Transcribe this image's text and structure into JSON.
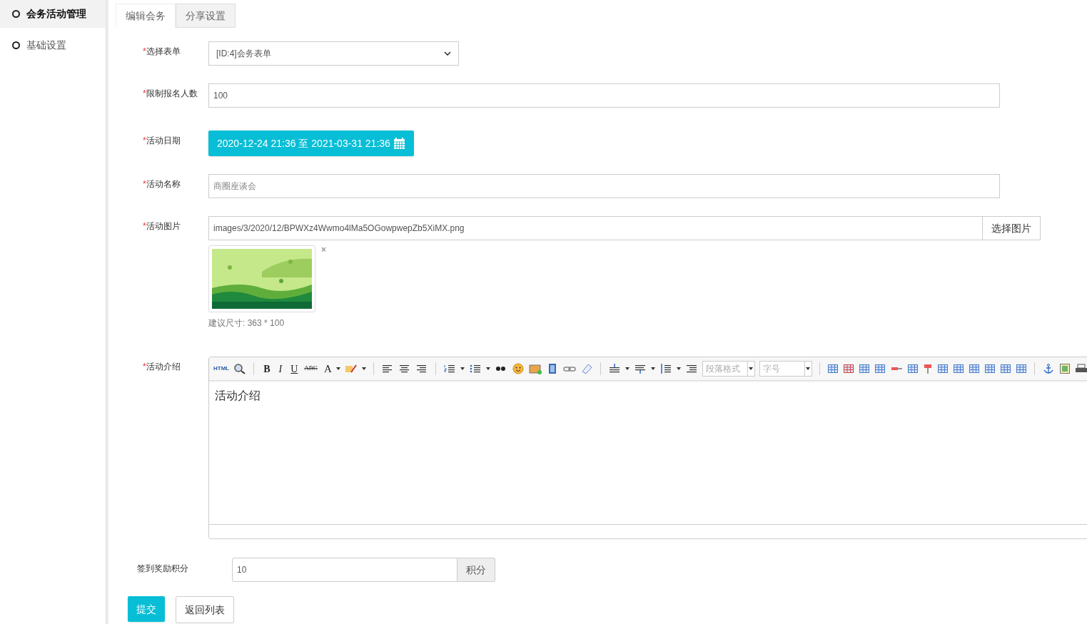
{
  "sidebar": {
    "items": [
      {
        "label": "会务活动管理",
        "selected": true
      },
      {
        "label": "基础设置",
        "selected": false
      }
    ]
  },
  "tabs": [
    {
      "label": "编辑会务",
      "selected": true
    },
    {
      "label": "分享设置",
      "selected": false
    }
  ],
  "form": {
    "required_mark": "*",
    "form_select": {
      "label": "选择表单",
      "value": "[ID:4]会务表单"
    },
    "limit": {
      "label": "限制报名人数",
      "value": "100"
    },
    "date": {
      "label": "活动日期",
      "value": "2020-12-24 21:36 至 2021-03-31 21:36"
    },
    "name": {
      "label": "活动名称",
      "placeholder": "商圈座谈会"
    },
    "image": {
      "label": "活动图片",
      "value": "images/3/2020/12/BPWXz4Wwmo4lMa5OGowpwepZb5XiMX.png",
      "button": "选择图片",
      "remove": "×",
      "hint": "建议尺寸: 363 * 100"
    },
    "intro": {
      "label": "活动介绍",
      "toolbar_labels": [
        "HTML",
        "B",
        "I",
        "U",
        "ABC",
        "A"
      ],
      "paragraph_placeholder": "段落格式",
      "size_placeholder": "字号",
      "content": "活动介绍"
    },
    "points": {
      "label": "签到奖励积分",
      "value": "10",
      "unit": "积分"
    }
  },
  "buttons": {
    "submit": "提交",
    "back": "返回列表"
  }
}
